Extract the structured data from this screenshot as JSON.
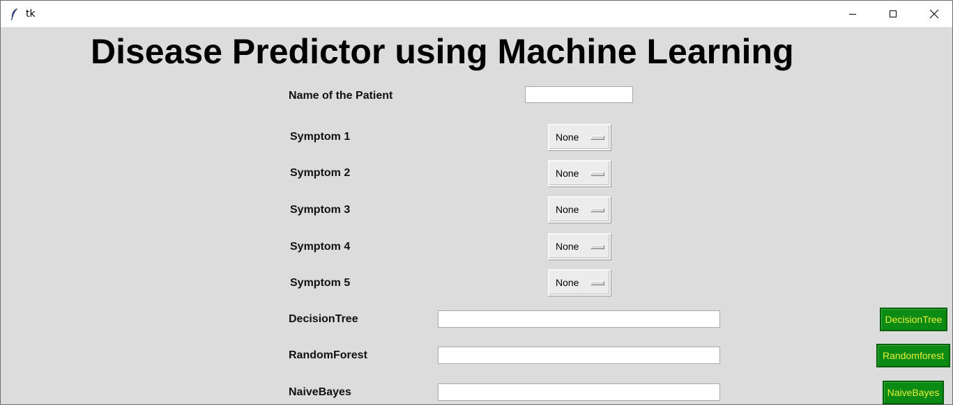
{
  "window": {
    "title": "tk"
  },
  "heading": "Disease Predictor using Machine Learning",
  "patient": {
    "label": "Name of the Patient",
    "value": ""
  },
  "symptoms": [
    {
      "label": "Symptom 1",
      "value": "None"
    },
    {
      "label": "Symptom 2",
      "value": "None"
    },
    {
      "label": "Symptom 3",
      "value": "None"
    },
    {
      "label": "Symptom 4",
      "value": "None"
    },
    {
      "label": "Symptom 5",
      "value": "None"
    }
  ],
  "results": [
    {
      "label": "DecisionTree",
      "value": "",
      "button": "DecisionTree"
    },
    {
      "label": "RandomForest",
      "value": "",
      "button": "Randomforest"
    },
    {
      "label": "NaiveBayes",
      "value": "",
      "button": "NaiveBayes"
    }
  ],
  "colors": {
    "background": "#dcdcdc",
    "button_bg": "#0b8a14",
    "button_text": "#e8f03a"
  }
}
